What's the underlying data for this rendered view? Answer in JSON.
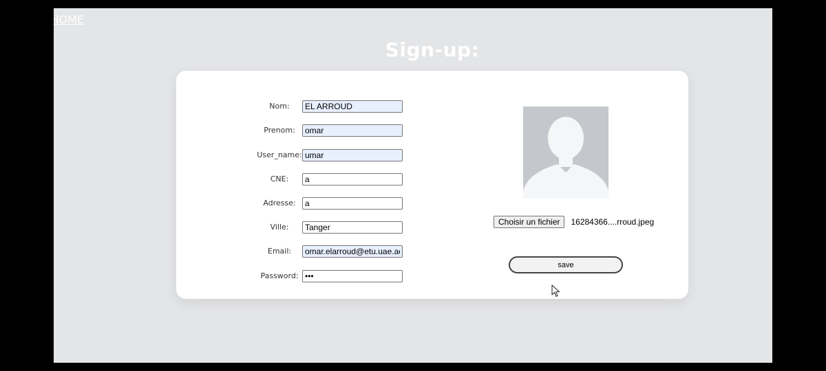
{
  "header": {
    "home_label": "HOME",
    "title": "Sign-up:"
  },
  "form": {
    "fields": [
      {
        "label": "Nom:",
        "value": "EL ARROUD",
        "type": "text",
        "autofill": true
      },
      {
        "label": "Prenom:",
        "value": "omar",
        "type": "text",
        "autofill": true
      },
      {
        "label": "User_name:",
        "value": "umar",
        "type": "text",
        "autofill": true
      },
      {
        "label": "CNE:",
        "value": "a",
        "type": "text",
        "autofill": false
      },
      {
        "label": "Adresse:",
        "value": "a",
        "type": "text",
        "autofill": false
      },
      {
        "label": "Ville:",
        "value": "Tanger",
        "type": "text",
        "autofill": false
      },
      {
        "label": "Email:",
        "value": "omar.elarroud@etu.uae.ac.ma",
        "type": "email",
        "autofill": true
      },
      {
        "label": "Password:",
        "value": "•••",
        "type": "password",
        "autofill": false
      }
    ]
  },
  "photo": {
    "icon": "user-silhouette-icon",
    "file_button_label": "Choisir un fichier",
    "file_name": "16284366....rroud.jpeg"
  },
  "actions": {
    "save_label": "save"
  },
  "colors": {
    "background": "#e4e5e7",
    "card": "#ffffff",
    "autofill": "#e8f0fe",
    "avatar_bg": "#c4c8cc",
    "avatar_fg": "#f5f6f7"
  }
}
